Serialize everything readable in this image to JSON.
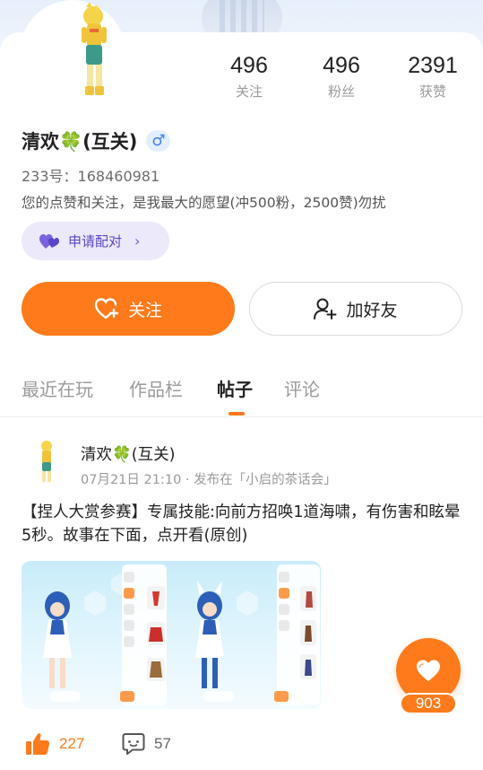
{
  "profile": {
    "name": "清欢🍀(互关)",
    "gender_symbol": "♂",
    "uid": "233号：168460981",
    "bio": "您的点赞和关注，是我最大的愿望(冲500粉，2500赞)勿扰"
  },
  "stats": [
    {
      "value": "496",
      "label": "关注"
    },
    {
      "value": "496",
      "label": "粉丝"
    },
    {
      "value": "2391",
      "label": "获赞"
    }
  ],
  "buttons": {
    "pair": "申请配对",
    "follow": "关注",
    "add_friend": "加好友"
  },
  "tabs": [
    {
      "label": "最近在玩"
    },
    {
      "label": "作品栏"
    },
    {
      "label": "帖子"
    },
    {
      "label": "评论"
    }
  ],
  "active_tab": "帖子",
  "post": {
    "author": "清欢🍀(互关)",
    "meta": "07月21日 21:10 · 发布在「小启的茶话会」",
    "text": "【捏人大赏参赛】专属技能:向前方招唤1道海啸，有伤害和眩晕5秒。故事在下面，点开看(原创)",
    "likes": "227",
    "comments": "57"
  },
  "floating_like": {
    "count": "903"
  },
  "colors": {
    "accent": "#ff7a1a",
    "pair_bg": "#ece9fb",
    "pair_text": "#5b43c9",
    "gender_bg": "#e3efff",
    "gender_fg": "#3b7cf0"
  }
}
